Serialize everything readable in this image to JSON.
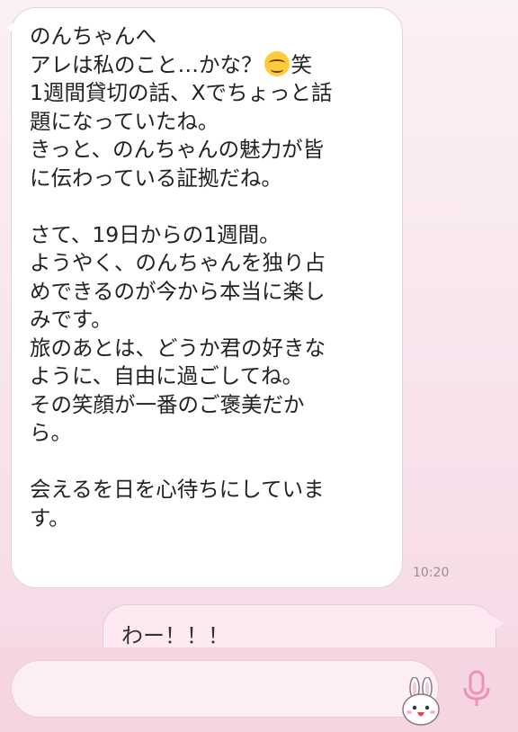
{
  "incoming_message": {
    "lines": [
      "のんちゃんへ",
      "アレは私のこと…かな？",
      "1週間貸切の話、Xでちょっと話",
      "題になっていたね。",
      "きっと、のんちゃんの魅力が皆",
      "に伝わっている証拠だね。",
      "",
      "さて、19日からの1週間。",
      "ようやく、のんちゃんを独り占",
      "めできるのが今から本当に楽し",
      "みです。",
      "旅のあとは、どうか君の好きな",
      "ように、自由に過ごしてね。",
      "その笑顔が一番のご褒美だか",
      "ら。",
      "",
      "会えるを日を心待ちにしていま",
      "す。"
    ],
    "line2_suffix": "笑",
    "emoji": "smiling-face-emoji",
    "time": "10:20"
  },
  "outgoing_message": {
    "text": "わー！！！"
  },
  "input_bar": {
    "sticker_icon": "bunny-sticker-icon",
    "mic_icon": "microphone-icon",
    "accent_color": "#f28fb6"
  }
}
